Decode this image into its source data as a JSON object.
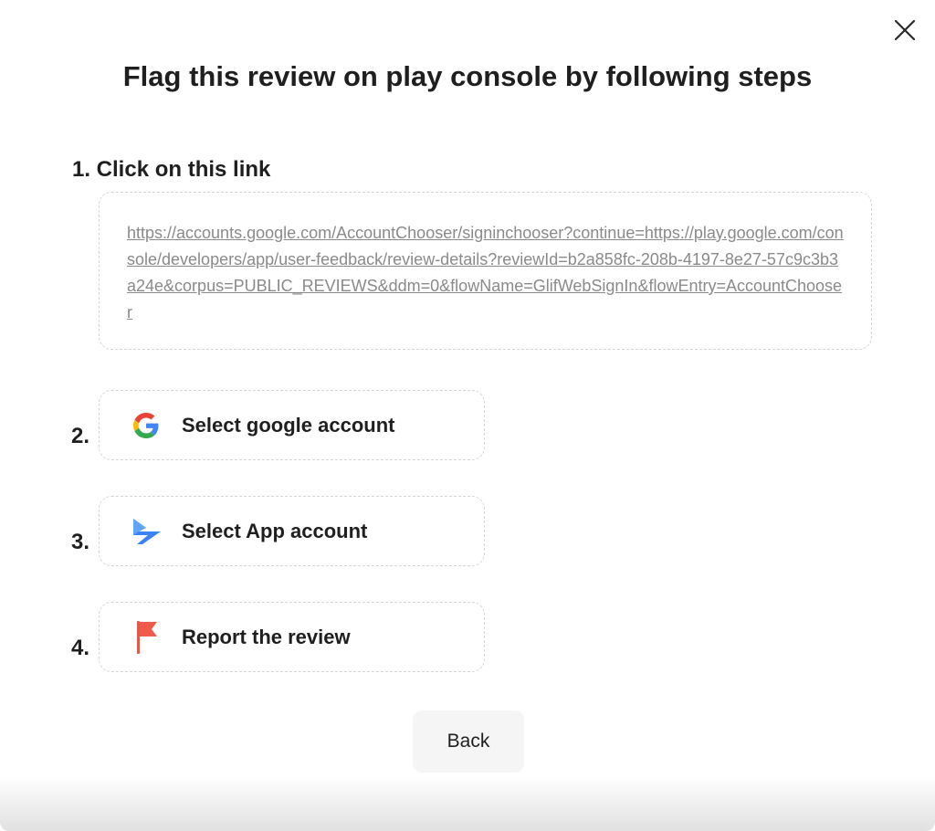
{
  "dialog": {
    "title": "Flag this review on play console by following steps",
    "close_icon": "close-icon"
  },
  "step1": {
    "label": "1. Click on this link",
    "link_text": "https://accounts.google.com/AccountChooser/signinchooser?continue=https://play.google.com/console/developers/app/user-feedback/review-details?reviewId=b2a858fc-208b-4197-8e27-57c9c3b3a24e&corpus=PUBLIC_REVIEWS&ddm=0&flowName=GlifWebSignIn&flowEntry=AccountChooser"
  },
  "steps": [
    {
      "number": "2.",
      "label": "Select google account",
      "icon": "google-icon"
    },
    {
      "number": "3.",
      "label": "Select App account",
      "icon": "app-logo-icon"
    },
    {
      "number": "4.",
      "label": "Report the review",
      "icon": "flag-icon"
    }
  ],
  "back_label": "Back",
  "colors": {
    "text": "#1f1f1f",
    "link": "#8a8a8a",
    "app_icon_blue": "#3b82f6",
    "flag_red": "#f05a4a"
  }
}
